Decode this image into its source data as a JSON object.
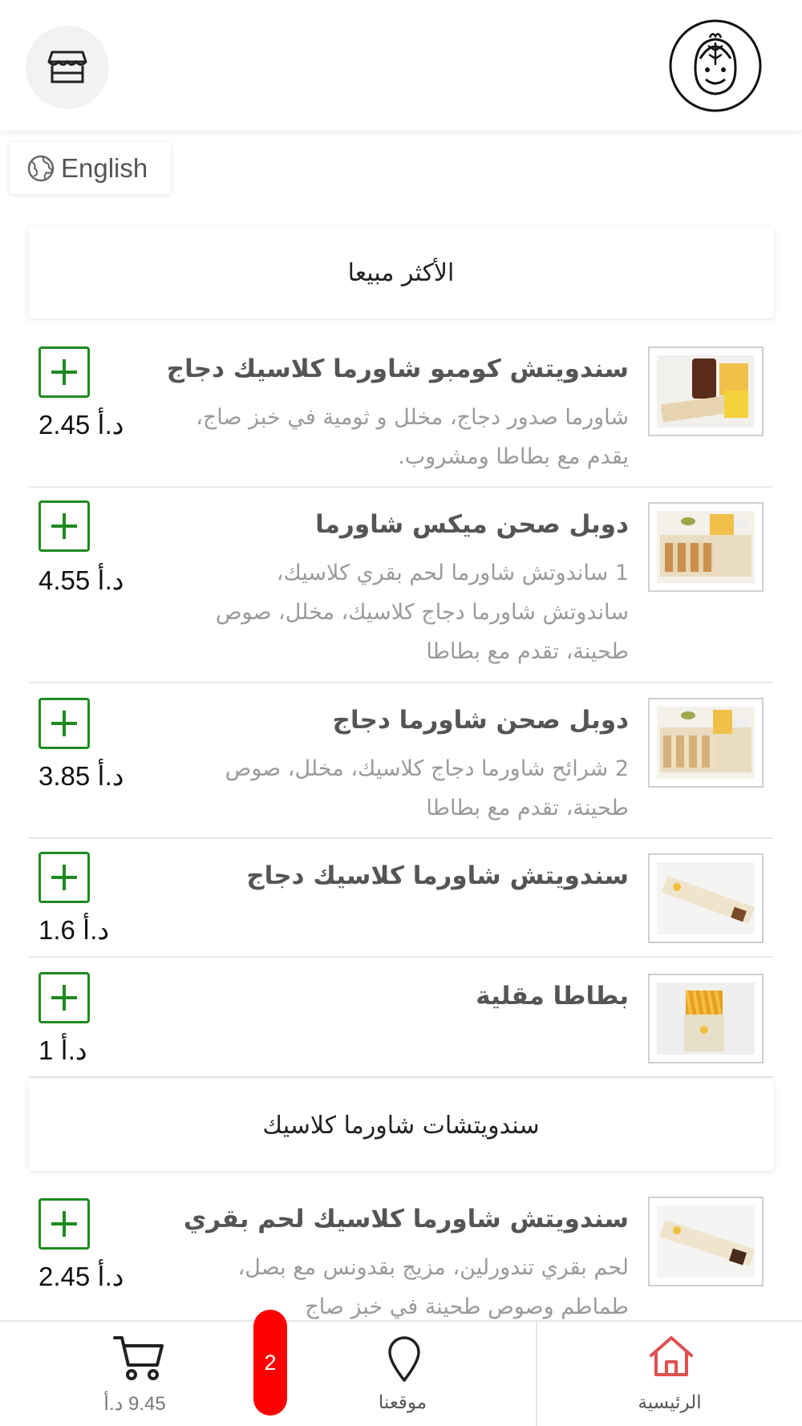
{
  "header": {
    "store_icon": "store-icon",
    "logo_icon": "brand-logo"
  },
  "language": {
    "label": "English",
    "icon": "globe-icon"
  },
  "sections": [
    {
      "title": "الأكثر مبيعا"
    },
    {
      "title": "سندويتشات شاورما كلاسيك"
    }
  ],
  "items": [
    {
      "title": "سندويتش كومبو شاورما كلاسيك دجاج",
      "description": "شاورما صدور دجاج، مخلل و ثومية في خبز صاج، يقدم مع بطاطا ومشروب.",
      "price": "2.45 د.أ",
      "image": "combo-sandwich-drink-fries"
    },
    {
      "title": "دوبل صحن ميكس شاورما",
      "description": "1 ساندوتش شاورما لحم بقري كلاسيك، ساندوتش شاورما دجاج كلاسيك، مخلل، صوص طحينة، تقدم مع بطاطا",
      "price": "4.55 د.أ",
      "image": "double-plate-mix"
    },
    {
      "title": "دوبل صحن شاورما دجاج",
      "description": "2 شرائح شاورما دجاج كلاسيك، مخلل، صوص طحينة، تقدم مع بطاطا",
      "price": "3.85 د.أ",
      "image": "double-plate-chicken"
    },
    {
      "title": "سندويتش شاورما كلاسيك دجاج",
      "description": "",
      "price": "1.6 د.أ",
      "image": "chicken-wrap"
    },
    {
      "title": "بطاطا مقلية",
      "description": "",
      "price": "1 د.أ",
      "image": "fries-box"
    },
    {
      "title": "سندويتش شاورما كلاسيك لحم بقري",
      "description": "لحم بقري تندورلين، مزيج بقدونس مع بصل، طماطم وصوص طحينة في خبز صاج",
      "price": "2.45 د.أ",
      "image": "beef-wrap"
    }
  ],
  "bottom_nav": {
    "home_label": "الرئيسية",
    "location_label": "موقعنا",
    "cart_total": "9.45 د.أ",
    "cart_count": "2"
  },
  "colors": {
    "accent_green": "#1e8a1e",
    "home_red": "#e05050",
    "badge_red": "#ff0000"
  }
}
